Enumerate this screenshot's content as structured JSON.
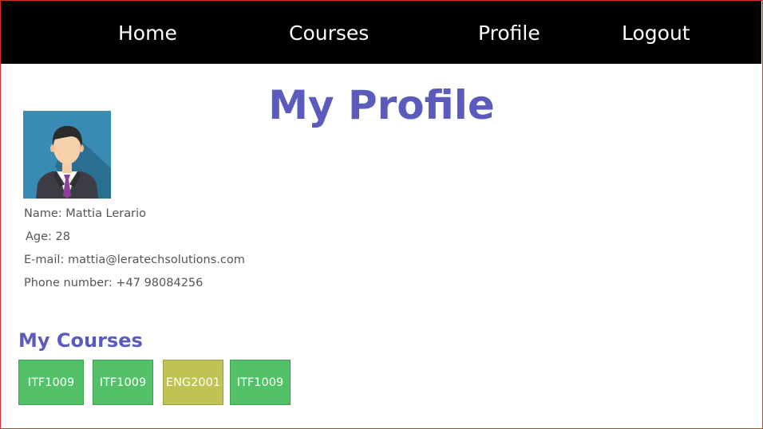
{
  "nav": {
    "home": "Home",
    "courses": "Courses",
    "profile": "Profile",
    "logout": "Logout"
  },
  "page_title": "My Profile",
  "profile": {
    "avatar_icon": "user-avatar-icon",
    "name": "Name: Mattia Lerario",
    "age": "Age: 28",
    "email": "E-mail: mattia@leratechsolutions.com",
    "phone": "Phone number: +47 98084256"
  },
  "courses_section": {
    "title": "My Courses",
    "items": [
      {
        "code": "ITF1009",
        "color": "#52c168"
      },
      {
        "code": "ITF1009",
        "color": "#52c168"
      },
      {
        "code": "ENG2001",
        "color": "#c1c255"
      },
      {
        "code": "ITF1009",
        "color": "#52c168"
      }
    ]
  },
  "colors": {
    "navbar": "#000000",
    "heading": "#5b5bbd",
    "course_green": "#52c168",
    "course_olive": "#c1c255"
  }
}
